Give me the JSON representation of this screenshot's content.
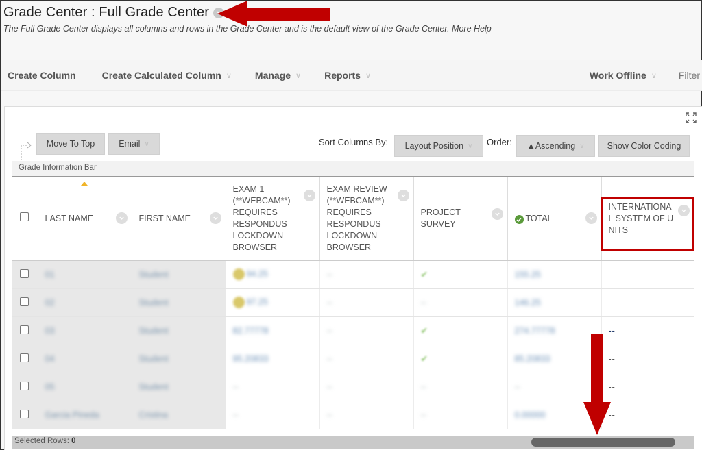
{
  "header": {
    "title": "Grade Center : Full Grade Center",
    "description": "The Full Grade Center displays all columns and rows in the Grade Center and is the default view of the Grade Center.",
    "more_help": "More Help"
  },
  "action_bar": {
    "items": [
      {
        "label": "Create Column",
        "has_menu": false
      },
      {
        "label": "Create Calculated Column",
        "has_menu": true
      },
      {
        "label": "Manage",
        "has_menu": true
      },
      {
        "label": "Reports",
        "has_menu": true
      }
    ],
    "right_items": [
      {
        "label": "Work Offline",
        "has_menu": true
      },
      {
        "label": "Filter",
        "has_menu": false
      }
    ]
  },
  "toolbar": {
    "move_to_top": "Move To Top",
    "email": "Email",
    "sort_columns_by_label": "Sort Columns By:",
    "sort_columns_by_value": "Layout Position",
    "order_label": "Order:",
    "order_value": "▲Ascending",
    "show_color_coding": "Show Color Coding"
  },
  "info_bar": "Grade Information Bar",
  "table": {
    "columns": [
      {
        "label": "LAST NAME"
      },
      {
        "label": "FIRST NAME"
      },
      {
        "label": "EXAM 1 (**WEBCAM**) - REQUIRES RESPONDUS LOCKDOWN BROWSER"
      },
      {
        "label": "EXAM REVIEW (**WEBCAM**) - REQUIRES RESPONDUS LOCKDOWN BROWSER"
      },
      {
        "label": "PROJECT SURVEY"
      },
      {
        "label": "TOTAL"
      },
      {
        "label": "INTERNATIONAL SYSTEM OF UNITS"
      }
    ],
    "sorted_column": "LAST NAME",
    "highlighted_column": "INTERNATIONAL SYSTEM OF UNITS",
    "rows": [
      {
        "last": "01",
        "first": "Student",
        "exam1": "94.25",
        "exam1_flag": "needs-grading",
        "review": "--",
        "survey": "✔",
        "total": "155.25",
        "isu": "--"
      },
      {
        "last": "02",
        "first": "Student",
        "exam1": "97.25",
        "exam1_flag": "needs-grading",
        "review": "--",
        "survey": "--",
        "total": "146.25",
        "isu": "--"
      },
      {
        "last": "03",
        "first": "Student",
        "exam1": "82.77778",
        "exam1_flag": "",
        "review": "--",
        "survey": "✔",
        "total": "274.77778",
        "isu": "--"
      },
      {
        "last": "04",
        "first": "Student",
        "exam1": "95.20833",
        "exam1_flag": "",
        "review": "--",
        "survey": "✔",
        "total": "85.20833",
        "isu": "--"
      },
      {
        "last": "05",
        "first": "Student",
        "exam1": "--",
        "exam1_flag": "",
        "review": "--",
        "survey": "--",
        "total": "--",
        "isu": "--"
      },
      {
        "last": "Garcia Pineda",
        "first": "Cristina",
        "exam1": "--",
        "exam1_flag": "",
        "review": "--",
        "survey": "--",
        "total": "0.00000",
        "isu": "--"
      }
    ]
  },
  "status": {
    "selected_rows_label": "Selected Rows:",
    "selected_rows_value": "0"
  },
  "colors": {
    "annotation_red": "#c00000",
    "total_ok_green": "#5a9a3a",
    "needs_grading_yellow": "#d9c86a"
  }
}
